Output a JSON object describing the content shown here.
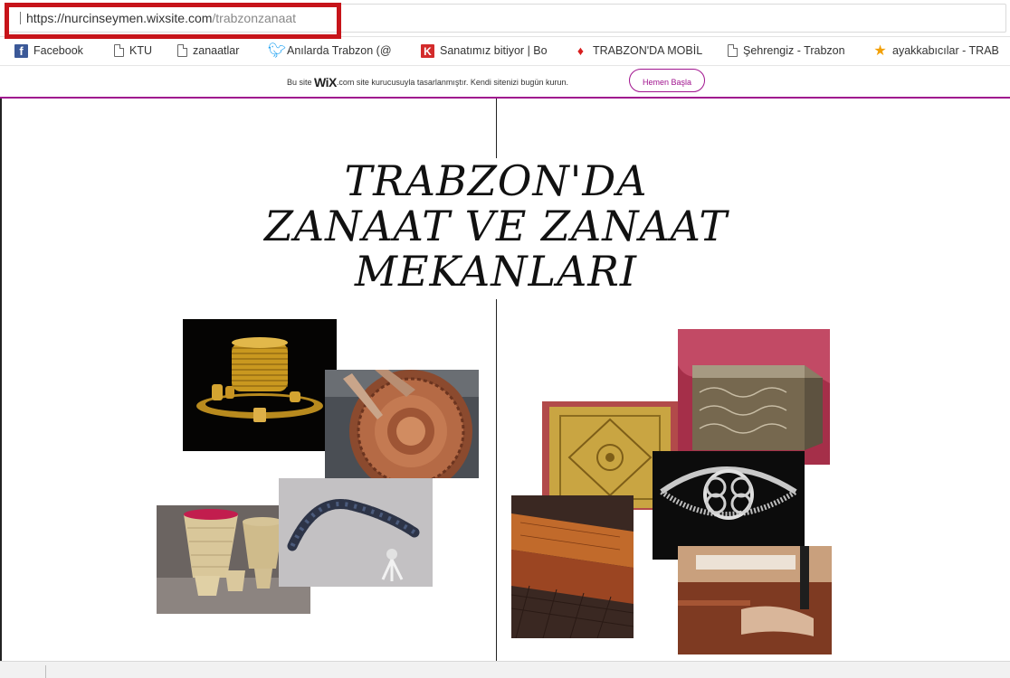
{
  "browser": {
    "url_host": "https://nurcinseymen.wixsite.com",
    "url_path": "/trabzonzanaat"
  },
  "bookmarks": [
    {
      "label": "Facebook",
      "icon": "facebook-icon"
    },
    {
      "label": "KTU",
      "icon": "page-icon"
    },
    {
      "label": "zanaatlar",
      "icon": "page-icon"
    },
    {
      "label": "Anılarda Trabzon (@",
      "icon": "twitter-icon"
    },
    {
      "label": "Sanatımız bitiyor | Bo",
      "icon": "k-icon"
    },
    {
      "label": "TRABZON'DA MOBİL",
      "icon": "flame-icon"
    },
    {
      "label": "Şehrengiz - Trabzon",
      "icon": "page-icon"
    },
    {
      "label": "ayakkabıcılar - TRAB",
      "icon": "star-icon"
    }
  ],
  "wix_banner": {
    "prefix": "Bu site ",
    "logo": "WiX",
    "suffix": ".com site kurucusuyla tasarlanmıştır. Kendi sitenizi bugün kurun.",
    "button_label": "Hemen Başla"
  },
  "page": {
    "title_lines": [
      "TRABZON'DA",
      "ZANAAT VE ZANAAT",
      "MEKANLARI"
    ]
  },
  "photos": [
    {
      "name": "gold-jewelry-photo",
      "subject": "gold jewelry set"
    },
    {
      "name": "copper-plate-photo",
      "subject": "copper engraving"
    },
    {
      "name": "baskets-photo",
      "subject": "woven baskets"
    },
    {
      "name": "prayer-beads-photo",
      "subject": "prayer beads"
    },
    {
      "name": "gold-fabric-photo",
      "subject": "gold embroidered fabric"
    },
    {
      "name": "ornate-box-photo",
      "subject": "ornate metal box"
    },
    {
      "name": "leather-photo",
      "subject": "leather samples"
    },
    {
      "name": "silver-bracelet-photo",
      "subject": "silver knit bracelet"
    },
    {
      "name": "sewing-photo",
      "subject": "leather sewing"
    }
  ],
  "colors": {
    "highlight_border": "#c7141a",
    "wix_accent": "#a0138e"
  }
}
